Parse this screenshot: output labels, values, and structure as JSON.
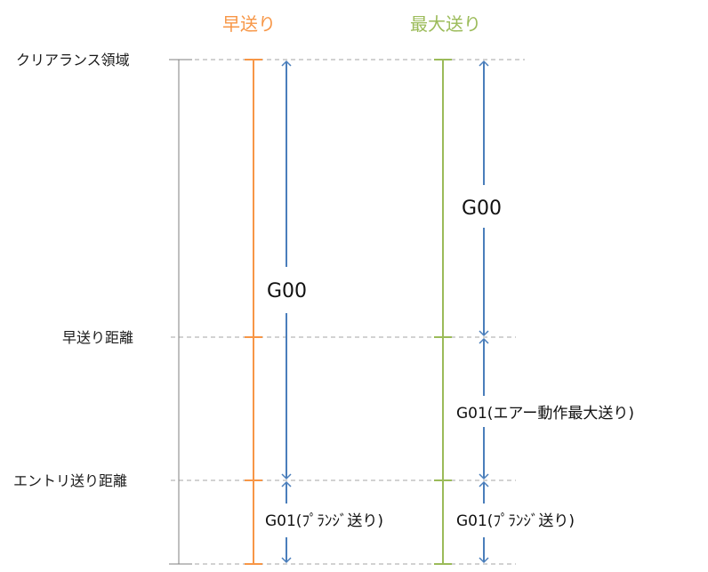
{
  "columns": {
    "rapid": {
      "title": "早送り",
      "color": "#F79646"
    },
    "max": {
      "title": "最大送り",
      "color": "#9BBB59"
    }
  },
  "levels": {
    "clearance": "クリアランス領域",
    "rapid_distance": "早送り距離",
    "entry_distance": "エントリ送り距離"
  },
  "segments": {
    "rapid_g00": "G00",
    "rapid_g01": "G01(ﾌﾟﾗﾝｼﾞ送り)",
    "max_g00": "G00",
    "max_g01_air": "G01(エアー動作最大送り)",
    "max_g01": "G01(ﾌﾟﾗﾝｼﾞ送り)"
  },
  "colors": {
    "arrow": "#4A7EBB",
    "guide": "#A6A6A6",
    "axis": "#7F7F7F"
  }
}
